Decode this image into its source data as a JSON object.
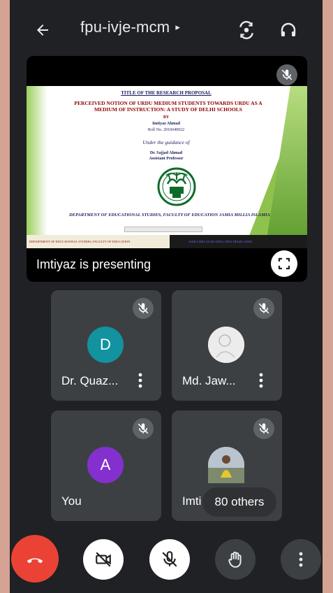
{
  "header": {
    "meeting_code": "fpu-ivje-mcm",
    "caret": "▸"
  },
  "presentation": {
    "presenter_label": "Imtiyaz is presenting",
    "slide": {
      "heading": "TITLE OF THE RESEARCH PROPOSAL",
      "topic": "PERCEIVED NOTION OF URDU MEDIUM STUDENTS TOWARDS URDU AS A MEDIUM OF INSTRUCTION: A STUDY OF DELHI SCHOOLS",
      "by": "BY",
      "author": "Imtiyaz Ahmad",
      "roll": "Roll No. 2016040022",
      "guidance": "Under the guidance of",
      "guide_name": "Dr. Sajjad Ahmad",
      "guide_title": "Assistant Professor",
      "department": "DEPARTMENT OF EDUCATIONAL STUDIES, FACULTY OF EDUCATION JAMIA MILLIA ISLAMIA",
      "footer_left": "DEPARTMENT OF EDUCATIONAL STUDIES, FACULTY OF EDUCATION",
      "footer_right": "JAMIA MILLIA ISLAMIA, NEW DELHI 110025"
    }
  },
  "participants": [
    {
      "name": "Dr. Quaz...",
      "avatar_letter": "D",
      "avatar_color": "#12939f"
    },
    {
      "name": "Md. Jaw...",
      "avatar_letter": "",
      "avatar_color": "#e9e9e9"
    },
    {
      "name": "You",
      "avatar_letter": "A",
      "avatar_color": "#8430ce"
    },
    {
      "name": "Imti",
      "avatar_letter": "",
      "avatar_color": "#9aa8b8"
    }
  ],
  "others_count_label": "80 others",
  "colors": {
    "end_call": "#ea4335",
    "tile_bg": "#3c4043",
    "app_bg": "#202124",
    "control_white": "#ffffff",
    "control_dark": "#3c4043"
  },
  "icons": {
    "back": "arrow-left-icon",
    "switch_camera": "camera-switch-icon",
    "audio": "headphones-icon",
    "mic_off": "mic-off-icon",
    "fullscreen": "fullscreen-icon",
    "more": "more-vert-icon",
    "end_call": "call-end-icon",
    "camera_off": "videocam-off-icon",
    "raise_hand": "hand-icon"
  }
}
